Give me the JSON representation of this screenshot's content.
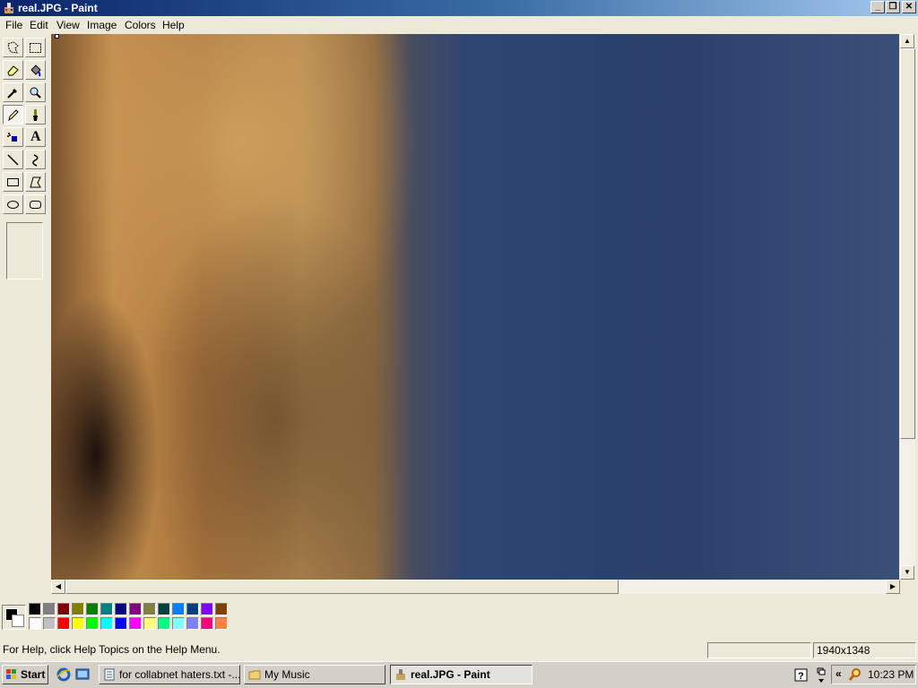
{
  "window": {
    "title": "real.JPG - Paint",
    "controls": {
      "minimize": "_",
      "maximize": "❐",
      "close": "✕"
    }
  },
  "menu": [
    "File",
    "Edit",
    "View",
    "Image",
    "Colors",
    "Help"
  ],
  "tools": [
    "free-form-select",
    "rect-select",
    "eraser",
    "fill-with-color",
    "pick-color",
    "magnifier",
    "pencil",
    "brush",
    "airbrush",
    "text",
    "line",
    "curve",
    "rectangle",
    "polygon",
    "ellipse",
    "rounded-rectangle"
  ],
  "active_tool": "pencil",
  "text_tool_glyph": "A",
  "palette": {
    "foreground": "#000000",
    "background": "#ffffff",
    "top_row": [
      "#000000",
      "#808080",
      "#800000",
      "#808000",
      "#008000",
      "#008080",
      "#000080",
      "#800080",
      "#808040",
      "#004040",
      "#0080ff",
      "#004080",
      "#8000ff",
      "#804000"
    ],
    "bottom_row": [
      "#ffffff",
      "#c0c0c0",
      "#ff0000",
      "#ffff00",
      "#00ff00",
      "#00ffff",
      "#0000ff",
      "#ff00ff",
      "#ffff80",
      "#00ff80",
      "#80ffff",
      "#8080ff",
      "#ff0080",
      "#ff8040"
    ]
  },
  "status": {
    "help_text": "For Help, click Help Topics on the Help Menu.",
    "position": "",
    "size": "1940x1348"
  },
  "taskbar": {
    "start_label": "Start",
    "tasks": [
      {
        "label": "for collabnet haters.txt -...",
        "active": false
      },
      {
        "label": "My Music",
        "active": false
      },
      {
        "label": "real.JPG - Paint",
        "active": true
      }
    ],
    "tray_chevron": "«",
    "clock": "10:23 PM"
  }
}
